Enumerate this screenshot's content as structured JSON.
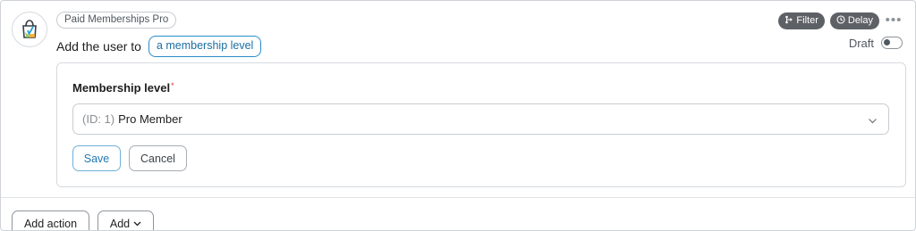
{
  "step": {
    "integration_name": "Paid Memberships Pro",
    "action_prefix": "Add the user to",
    "action_token": "a membership level",
    "logo_icon": "paid-memberships-pro-logo"
  },
  "toolbar": {
    "filter_label": "Filter",
    "filter_icon": "filter-branch-icon",
    "delay_label": "Delay",
    "delay_icon": "clock-icon",
    "more_label": "•••",
    "draft_label": "Draft",
    "draft_enabled": false
  },
  "form": {
    "field_label": "Membership level",
    "required_mark": "*",
    "selected_id": "(ID: 1)",
    "selected_value": "Pro Member",
    "save_label": "Save",
    "cancel_label": "Cancel"
  },
  "footer": {
    "add_action_label": "Add action",
    "add_label": "Add"
  },
  "colors": {
    "accent": "#2a8dc7",
    "dark_chip": "#5d6166",
    "required": "#d63638"
  }
}
